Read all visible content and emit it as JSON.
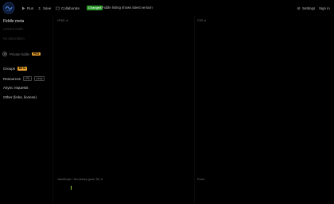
{
  "toolbar": {
    "run_label": "Run",
    "save_label": "Save",
    "collaborate_label": "Collaborate",
    "changed_label": "Changed",
    "changed_note": "Fiddle listing shows latest version",
    "settings_label": "Settings",
    "signin_label": "Sign in",
    "accent_color": "#2e9a2e"
  },
  "sidebar": {
    "title": "Fiddle meta",
    "title_placeholder": "Untitled fiddle",
    "description_placeholder": "No description",
    "private_label": "Private fiddle",
    "private_badge": "PRO",
    "groups_label": "Groups",
    "groups_badge": "BETA",
    "resources_label": "Resources",
    "resources_url_label": "URL",
    "resources_count": "cdnjs",
    "async_label": "Async requests",
    "other_label": "Other (links, license)"
  },
  "panes": {
    "html_label": "HTML",
    "css_label": "CSS",
    "js_label": "JavaScript + No-Library (pure JS)",
    "reset_label": "Reset"
  }
}
